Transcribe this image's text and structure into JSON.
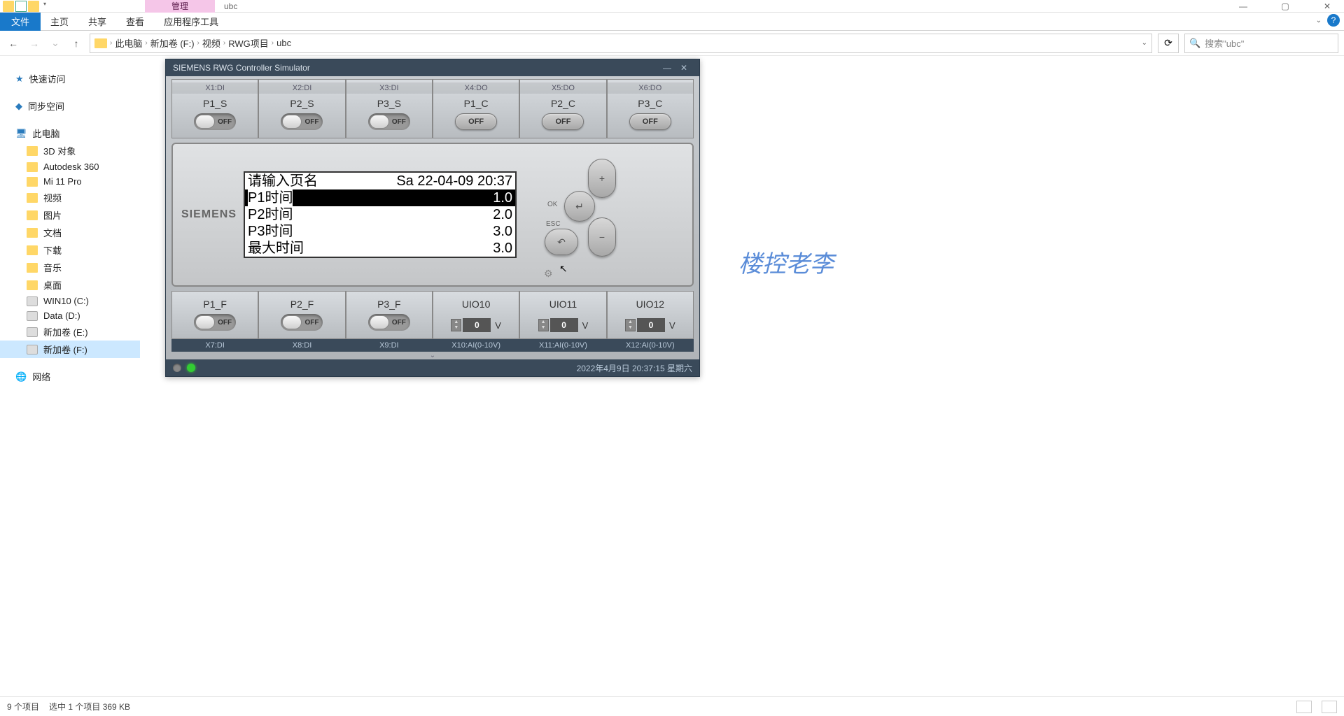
{
  "window": {
    "context_tab": "管理",
    "title": "ubc",
    "min": "—",
    "max": "▢",
    "close": "✕"
  },
  "ribbon": {
    "file": "文件",
    "tabs": [
      "主页",
      "共享",
      "查看",
      "应用程序工具"
    ],
    "help": "?"
  },
  "address": {
    "back": "←",
    "forward": "→",
    "recent": "⌄",
    "up": "↑",
    "crumbs": [
      "此电脑",
      "新加卷 (F:)",
      "视频",
      "RWG项目",
      "ubc"
    ],
    "refresh": "⟳",
    "search_placeholder": "搜索\"ubc\""
  },
  "sidebar": {
    "quick": "快速访问",
    "sync": "同步空间",
    "pc": "此电脑",
    "pc_items": [
      "3D 对象",
      "Autodesk 360",
      "Mi 11 Pro",
      "视频",
      "图片",
      "文档",
      "下载",
      "音乐",
      "桌面",
      "WIN10 (C:)",
      "Data (D:)",
      "新加卷 (E:)",
      "新加卷 (F:)"
    ],
    "network": "网络"
  },
  "simulator": {
    "title": "SIEMENS RWG Controller Simulator",
    "top_ports": [
      "X1:DI",
      "X2:DI",
      "X3:DI",
      "X4:DO",
      "X5:DO",
      "X6:DO"
    ],
    "top_names": [
      "P1_S",
      "P2_S",
      "P3_S",
      "P1_C",
      "P2_C",
      "P3_C"
    ],
    "toggle_off": "OFF",
    "brand": "SIEMENS",
    "lcd": {
      "header_l": "请输入页名",
      "header_r": "Sa 22-04-09 20:37",
      "rows": [
        {
          "l": "P1时间",
          "r": "1.0"
        },
        {
          "l": "P2时间",
          "r": "2.0"
        },
        {
          "l": "P3时间",
          "r": "3.0"
        },
        {
          "l": "最大时间",
          "r": "3.0"
        }
      ]
    },
    "btn_ok": "OK",
    "btn_esc": "ESC",
    "bot_names": [
      "P1_F",
      "P2_F",
      "P3_F",
      "UIO10",
      "UIO11",
      "UIO12"
    ],
    "uio_val": "0",
    "uio_unit": "V",
    "bot_ports": [
      "X7:DI",
      "X8:DI",
      "X9:DI",
      "X10:AI(0-10V)",
      "X11:AI(0-10V)",
      "X12:AI(0-10V)"
    ],
    "status_time": "2022年4月9日  20:37:15 星期六"
  },
  "watermark": "楼控老李",
  "statusbar": {
    "count": "9 个项目",
    "selection": "选中 1 个项目  369 KB"
  }
}
